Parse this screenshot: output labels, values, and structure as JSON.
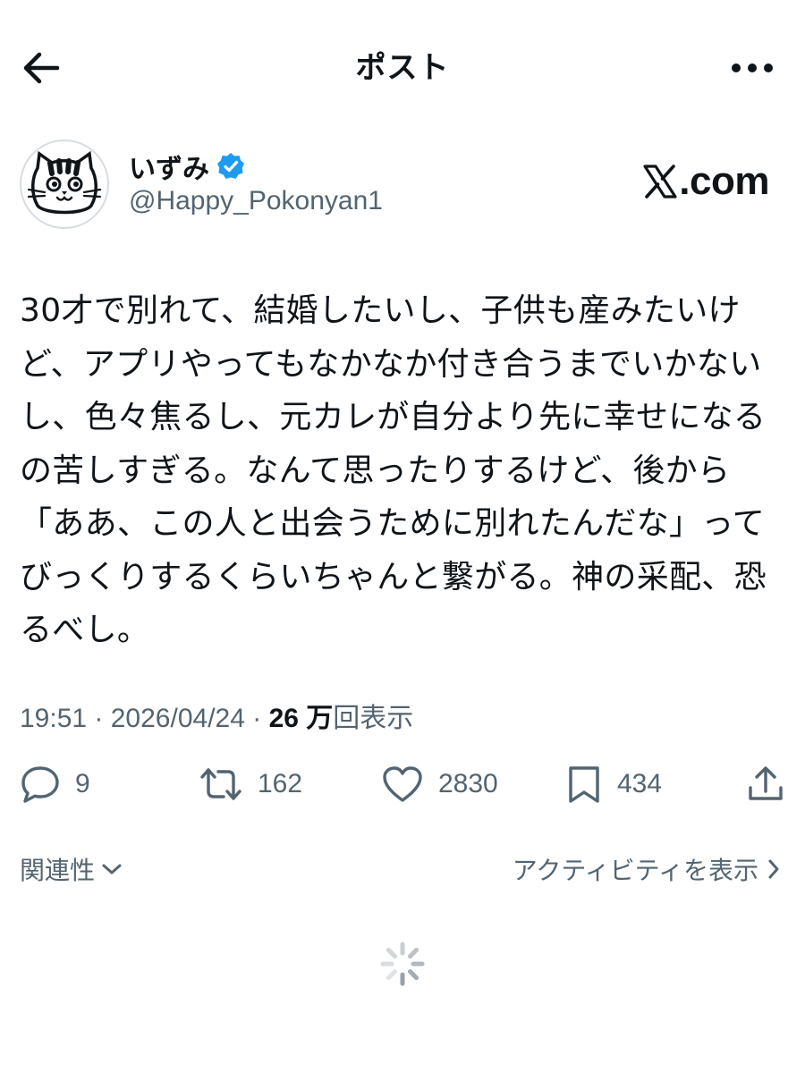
{
  "header": {
    "title": "ポスト",
    "back_icon": "arrow-left-icon",
    "more_icon": "more-horizontal-icon"
  },
  "author": {
    "name": "いずみ",
    "handle": "@Happy_Pokonyan1",
    "verified_icon": "verified-badge-icon",
    "verified_color": "#1d9bf0",
    "avatar_icon": "cat-face-avatar"
  },
  "brand": {
    "text": ".com",
    "logo_icon": "x-logo-icon"
  },
  "post": {
    "text": "30才で別れて、結婚したいし、子供も産みたいけ\nど、アプリやってもなかなか付き合うまでいかない\nし、色々焦るし、元カレが自分より先に幸せになる\nの苦しすぎる。なんて思ったりするけど、後から\n「ああ、この人と出会うために別れたんだな」って\nびっくりするくらいちゃんと繋がる。神の采配、恐\nるべし。"
  },
  "meta": {
    "time": "19:51",
    "separator": " · ",
    "date": "2026/04/24",
    "views_count": "26 万",
    "views_label": "回表示"
  },
  "actions": {
    "reply": {
      "icon": "reply-icon",
      "count": "9"
    },
    "repost": {
      "icon": "repost-icon",
      "count": "162"
    },
    "like": {
      "icon": "heart-icon",
      "count": "2830"
    },
    "bookmark": {
      "icon": "bookmark-icon",
      "count": "434"
    },
    "share": {
      "icon": "share-icon"
    }
  },
  "footer": {
    "related_label": "関連性",
    "activity_label": "アクティビティを表示"
  },
  "colors": {
    "text": "#0f1419",
    "secondary": "#536471",
    "accent": "#1d9bf0"
  }
}
